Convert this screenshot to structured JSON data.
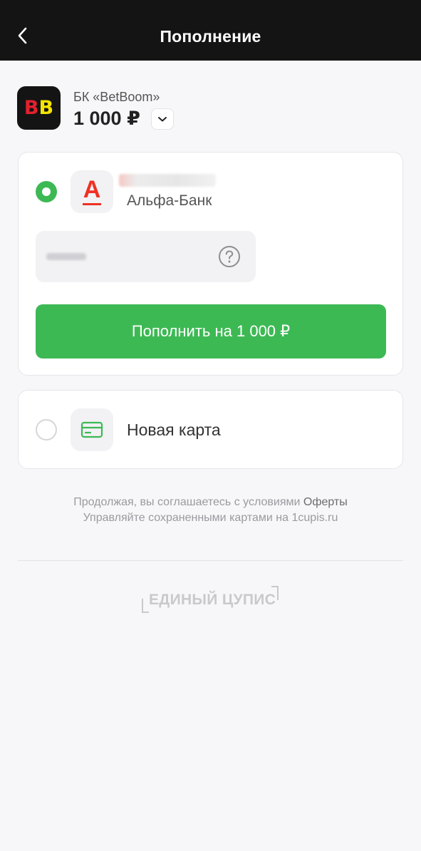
{
  "header": {
    "title": "Пополнение",
    "back_icon": "chevron-left-icon"
  },
  "merchant": {
    "logo_text_left": "B",
    "logo_text_right": "B",
    "name": "БК «BetBoom»",
    "amount": "1 000 ₽",
    "toggle_icon": "chevron-down-icon"
  },
  "saved_card": {
    "bank_logo_letter": "А",
    "bank_name": "Альфа-Банк",
    "help_icon": "question-circle-icon",
    "pay_button_label": "Пополнить на 1 000 ₽",
    "selected": true
  },
  "new_card": {
    "label": "Новая карта",
    "icon": "credit-card-icon",
    "selected": false
  },
  "footer": {
    "agreement_prefix": "Продолжая, вы соглашаетесь с условиями ",
    "agreement_link": "Оферты",
    "manage_text": "Управляйте сохраненными картами на 1cupis.ru",
    "brand": "ЕДИНЫЙ ЦУПИС"
  },
  "colors": {
    "accent_green": "#3db954",
    "alfa_red": "#ef3124",
    "betboom_red": "#e4202e",
    "betboom_yellow": "#f6e400",
    "header_bg": "#141414"
  }
}
